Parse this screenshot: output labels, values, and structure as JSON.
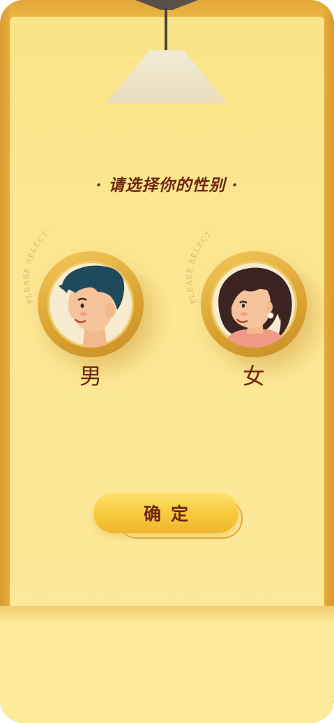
{
  "title": "· 请选择你的性别 ·",
  "ring_text": "· PLEASE SELECT YOUR GENDER ·",
  "options": [
    {
      "label": "男",
      "icon": "male-avatar-icon"
    },
    {
      "label": "女",
      "icon": "female-avatar-icon"
    }
  ],
  "confirm_label": "确定",
  "colors": {
    "background": "#fde897",
    "frame": "#e3a83a",
    "accent": "#f7c93a",
    "text": "#6e2612"
  }
}
